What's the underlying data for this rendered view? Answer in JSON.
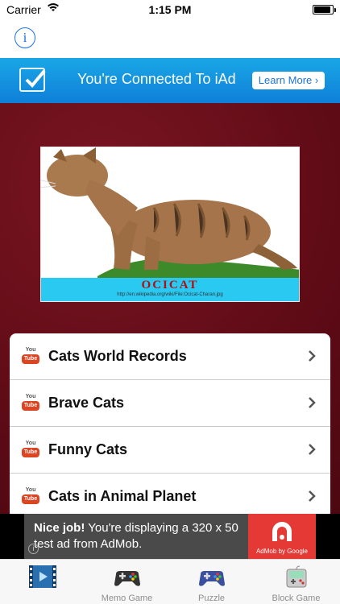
{
  "status": {
    "carrier": "Carrier",
    "time": "1:15 PM"
  },
  "nav": {
    "info_icon": "i"
  },
  "iad": {
    "message": "You're Connected To iAd",
    "button": "Learn More ›"
  },
  "photo": {
    "caption": "OCICAT",
    "source": "http://en.wikipedia.org/wiki/File:Ocicat-Charan.jpg"
  },
  "list": {
    "items": [
      {
        "label": "Cats World Records",
        "badge_top": "You",
        "badge_bottom": "Tube"
      },
      {
        "label": "Brave Cats",
        "badge_top": "You",
        "badge_bottom": "Tube"
      },
      {
        "label": "Funny Cats",
        "badge_top": "You",
        "badge_bottom": "Tube"
      },
      {
        "label": "Cats in Animal Planet",
        "badge_top": "You",
        "badge_bottom": "Tube"
      }
    ]
  },
  "admob": {
    "title": "Nice job!",
    "text": "You're displaying a 320 x 50 test ad from AdMob.",
    "brand": "AdMob by Google"
  },
  "tabs": [
    {
      "label": "",
      "icon": "video-icon"
    },
    {
      "label": "Memo Game",
      "icon": "gamepad-icon"
    },
    {
      "label": "Puzzle",
      "icon": "gamepad-icon"
    },
    {
      "label": "Block Game",
      "icon": "handheld-console-icon"
    }
  ],
  "colors": {
    "iad_blue": "#1aa7e6",
    "background_red": "#6b0f1a",
    "admob_red": "#e53935"
  }
}
